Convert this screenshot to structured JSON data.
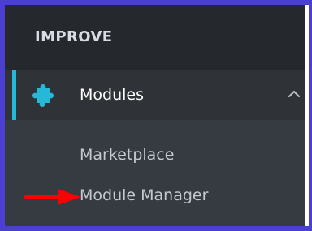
{
  "sidebar": {
    "section_title": "IMPROVE",
    "modules_item": {
      "label": "Modules",
      "icon": "puzzle-icon",
      "expanded_icon": "chevron-up-icon"
    },
    "submenu": {
      "items": [
        {
          "label": "Marketplace"
        },
        {
          "label": "Module Manager"
        }
      ]
    }
  },
  "annotation": {
    "icon": "red-arrow-icon",
    "color": "#ff0000"
  },
  "colors": {
    "frame_border": "#4b3fd1",
    "panel_background": "#363a41",
    "header_background": "#25282d",
    "active_bar": "#25b9d7",
    "puzzle_icon": "#25b9d7"
  }
}
